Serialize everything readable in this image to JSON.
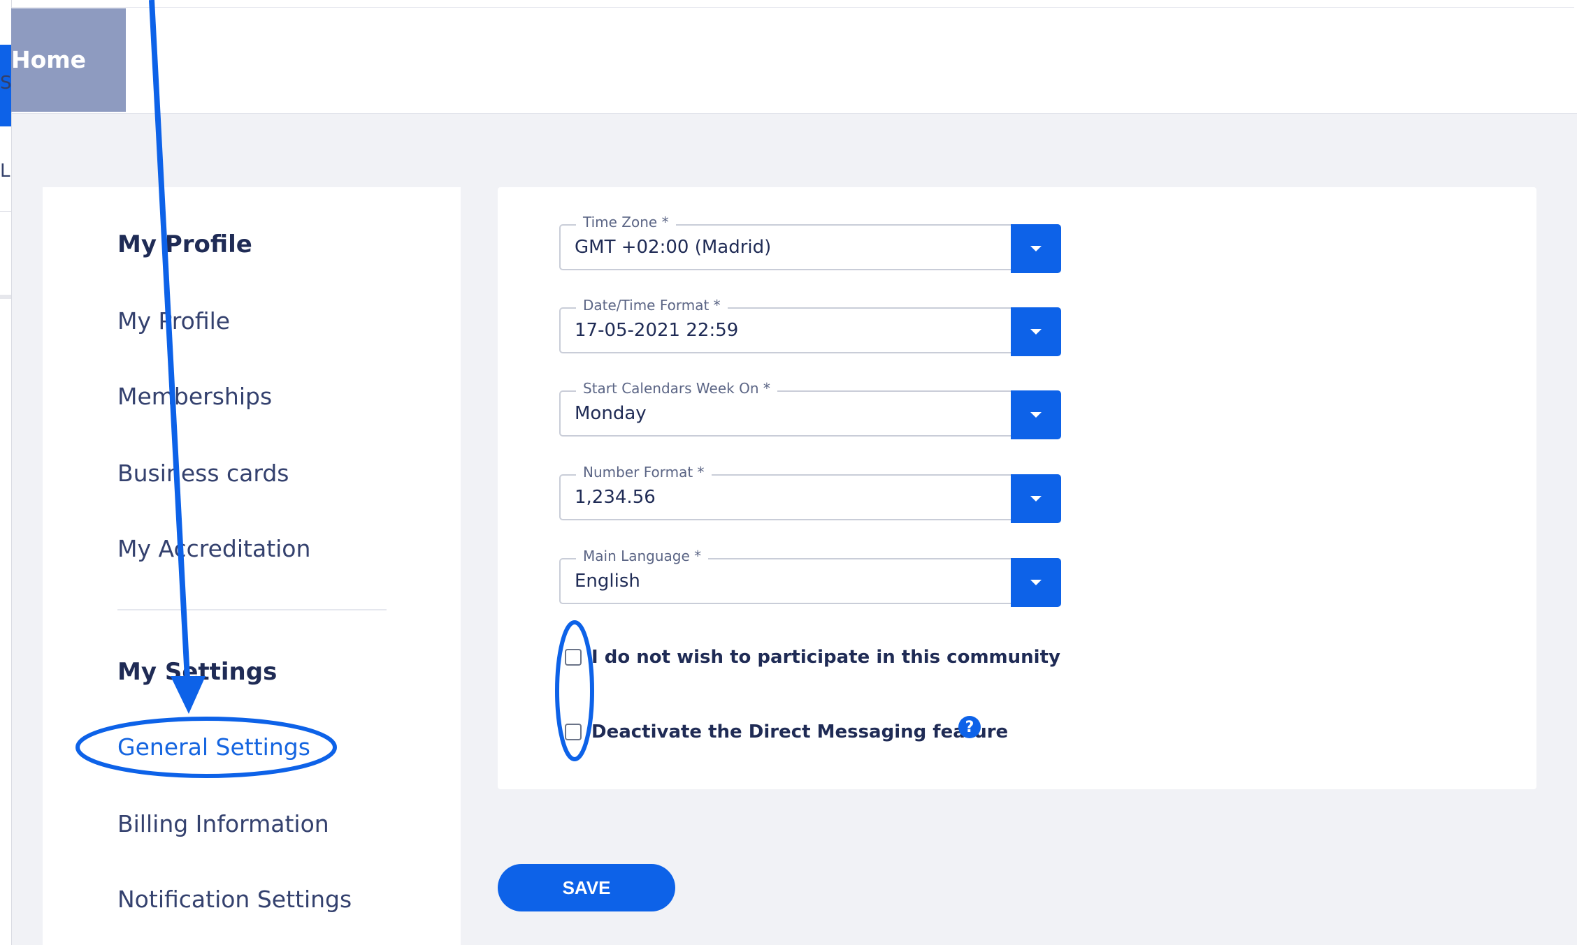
{
  "nav": {
    "home_tab": "Home",
    "edge_letters": [
      "S",
      "L"
    ]
  },
  "sidebar": {
    "profile_heading": "My Profile",
    "profile_items": [
      "My Profile",
      "Memberships",
      "Business cards",
      "My Accreditation"
    ],
    "settings_heading": "My Settings",
    "settings_items": [
      "General Settings",
      "Billing Information",
      "Notification Settings"
    ],
    "active_item": "General Settings"
  },
  "form": {
    "time_zone": {
      "label": "Time Zone *",
      "value": "GMT +02:00 (Madrid)"
    },
    "datetime_format": {
      "label": "Date/Time Format *",
      "value": "17-05-2021 22:59"
    },
    "week_start": {
      "label": "Start Calendars Week On *",
      "value": "Monday"
    },
    "number_format": {
      "label": "Number Format *",
      "value": "1,234.56"
    },
    "main_language": {
      "label": "Main Language *",
      "value": "English"
    },
    "no_participate_label": "I do not wish to participate in this community",
    "no_participate_checked": false,
    "deactivate_dm_label": "Deactivate the Direct Messaging feature",
    "deactivate_dm_checked": false,
    "help_glyph": "?",
    "save_label": "SAVE"
  },
  "colors": {
    "accent": "#0d62e8",
    "annotation": "#0d62e8",
    "home_tab": "#8e9bc0"
  },
  "icons": [
    "chevron-down-icon",
    "help-icon"
  ]
}
